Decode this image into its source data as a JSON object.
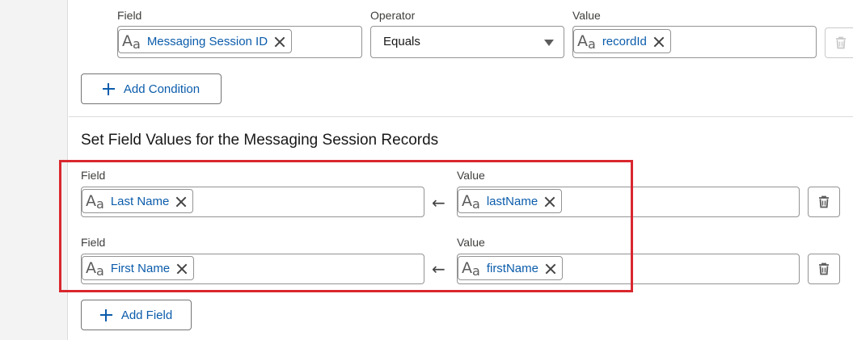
{
  "condition": {
    "field_label": "Field",
    "operator_label": "Operator",
    "value_label": "Value",
    "field_value": "Messaging Session ID",
    "operator_value": "Equals",
    "value_value": "recordId",
    "add_condition": "Add Condition"
  },
  "field_values": {
    "section_title": "Set Field Values for the Messaging Session Records",
    "rows": [
      {
        "field_label": "Field",
        "value_label": "Value",
        "field": "Last Name",
        "value": "lastName"
      },
      {
        "field_label": "Field",
        "value_label": "Value",
        "field": "First Name",
        "value": "firstName"
      }
    ],
    "add_field": "Add Field"
  },
  "icons": {
    "type_icon_big": "A",
    "type_icon_small": "a",
    "arrow": "←",
    "delete": "trash-icon",
    "remove": "close-icon",
    "add": "plus-icon",
    "dropdown": "chevron-down-icon"
  },
  "colors": {
    "link_blue": "#0b5cab",
    "highlight_red": "#d9272e",
    "border": "#939393"
  }
}
